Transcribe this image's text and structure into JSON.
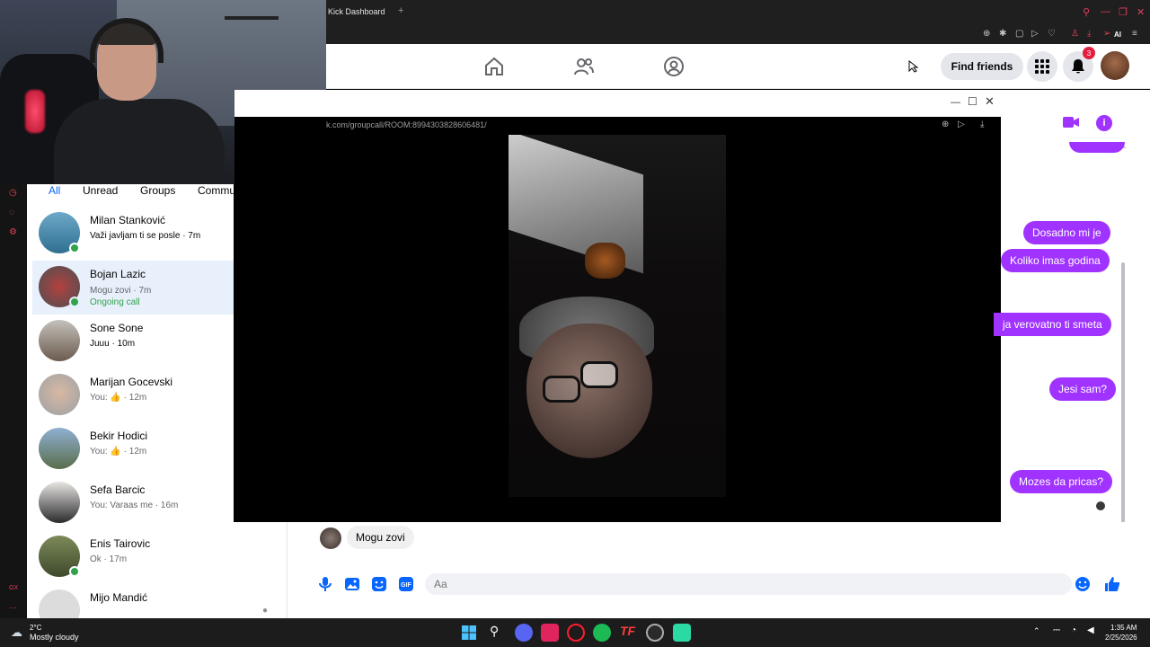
{
  "browser": {
    "tab_title": "Kick Dashboard",
    "new_tab_glyph": "+",
    "window_controls": [
      "search-icon",
      "minimize-icon",
      "restore-icon",
      "close-icon"
    ],
    "toolbar_ai": "AI"
  },
  "header": {
    "nav_icons": [
      "home-icon",
      "friends-icon",
      "groups-icon"
    ],
    "find_friends_label": "Find friends",
    "notification_count": "3",
    "menu_icon": "apps-grid-icon",
    "bell_icon": "bell-icon"
  },
  "sidebar": {
    "filters": [
      "All",
      "Unread",
      "Groups",
      "Commu"
    ],
    "chats": [
      {
        "name": "Milan Stanković",
        "preview": "Važi javljam ti se posle · 7m",
        "online": true,
        "unread": true
      },
      {
        "name": "Bojan Lazic",
        "preview": "Mogu zovi · 7m",
        "status": "Ongoing call",
        "online": true,
        "selected": true
      },
      {
        "name": "Sone Sone",
        "preview": "Juuu · 10m",
        "online": false,
        "unread": true
      },
      {
        "name": "Marijan Gocevski",
        "preview": "You: 👍 · 12m",
        "online": false
      },
      {
        "name": "Bekir Hodici",
        "preview": "You: 👍 · 12m",
        "online": false
      },
      {
        "name": "Sefa Barcic",
        "preview": "You: Varaas me · 16m",
        "online": false
      },
      {
        "name": "Enis Tairovic",
        "preview": "Ok · 17m",
        "online": true
      },
      {
        "name": "Mijo Mandić",
        "preview": "",
        "online": false
      }
    ]
  },
  "call": {
    "url": "k.com/groupcall/ROOM:8994303828606481/",
    "controls": [
      "minimize-icon",
      "maximize-icon",
      "close-icon"
    ]
  },
  "conversation": {
    "sent_messages": [
      "Dosadno mi je",
      "Koliko imas godina",
      "ja verovatno ti smeta",
      "Jesi sam?",
      "Mozes da pricas?"
    ],
    "received_message": "Mogu zovi",
    "input_placeholder": "Aa",
    "accent_color": "#a033ff"
  },
  "taskbar": {
    "weather_temp": "2°C",
    "weather_desc": "Mostly cloudy",
    "time": "1:35 AM",
    "date": "2/25/2026"
  }
}
